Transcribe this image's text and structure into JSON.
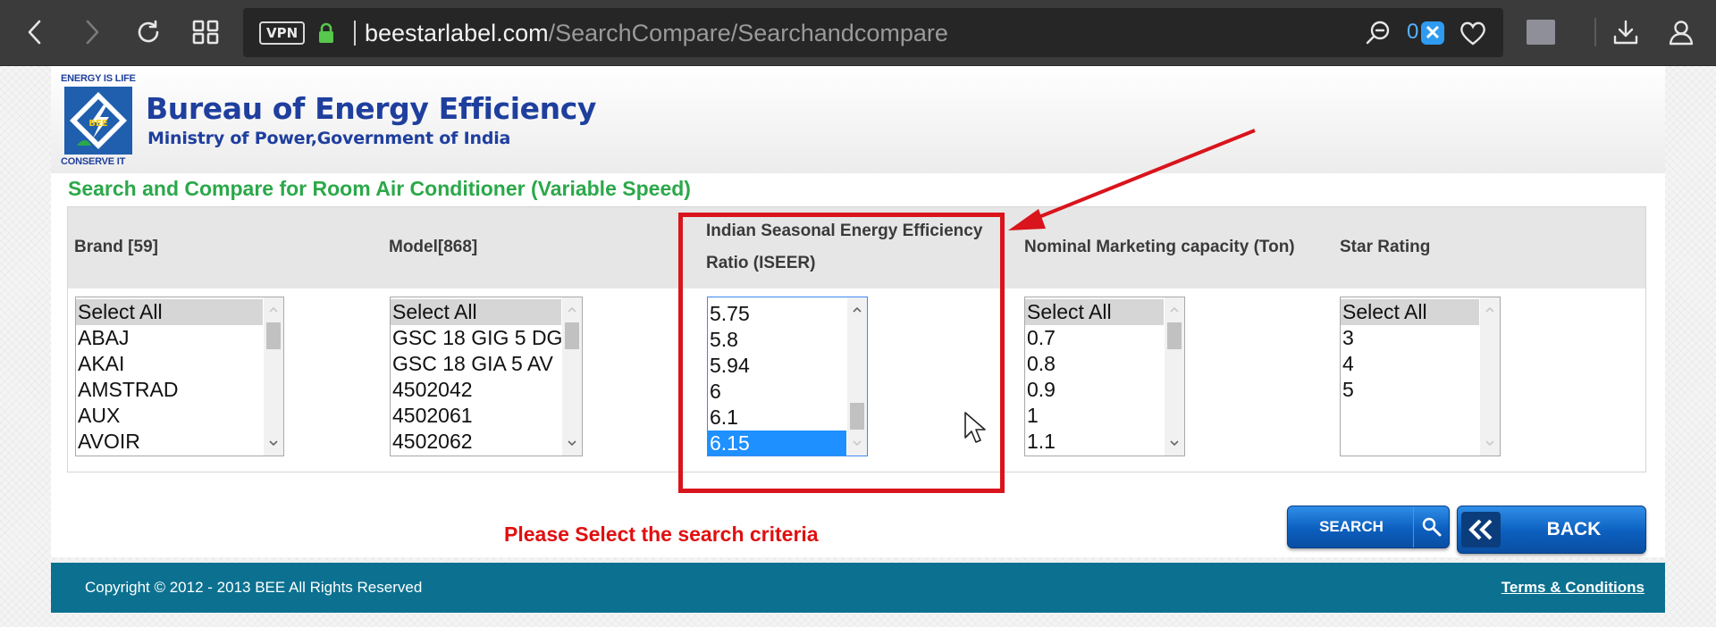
{
  "browser": {
    "vpn_label": "VPN",
    "url_host": "beestarlabel.com",
    "url_path": "/SearchCompare/Searchandcompare",
    "tracker_count": "0"
  },
  "header": {
    "logo_top_text": "ENERGY IS LIFE",
    "logo_bottom_text": "CONSERVE IT",
    "logo_emblem_text": "BEE",
    "org_name": "Bureau of Energy Efficiency",
    "org_sub": "Ministry of Power,Government of India"
  },
  "page_title": "Search and Compare for Room Air Conditioner (Variable Speed)",
  "columns": {
    "brand": {
      "label": "Brand [59]",
      "options": [
        "Select All",
        "ABAJ",
        "AKAI",
        "AMSTRAD",
        "AUX",
        "AVOIR"
      ],
      "selected": "Select All"
    },
    "model": {
      "label": "Model[868]",
      "options": [
        "Select All",
        "GSC 18 GIG 5 DG",
        "GSC 18 GIA 5 AV",
        "4502042",
        "4502061",
        "4502062"
      ],
      "selected": "Select All"
    },
    "iseer": {
      "label_line1": "Indian Seasonal Energy Efficiency",
      "label_line2": "Ratio (ISEER)",
      "options": [
        "5.75",
        "5.8",
        "5.94",
        "6",
        "6.1",
        "6.15"
      ],
      "selected": "6.15"
    },
    "capacity": {
      "label": "Nominal Marketing capacity (Ton)",
      "options": [
        "Select All",
        "0.7",
        "0.8",
        "0.9",
        "1",
        "1.1"
      ],
      "selected": "Select All"
    },
    "star": {
      "label": "Star Rating",
      "options": [
        "Select All",
        "3",
        "4",
        "5"
      ],
      "selected": "Select All"
    }
  },
  "status_message": "Please Select the search criteria",
  "buttons": {
    "search": "SEARCH",
    "back": "BACK"
  },
  "footer": {
    "copyright": "Copyright © 2012 - 2013 BEE All Rights Reserved",
    "terms": "Terms & Conditions"
  },
  "colors": {
    "title_green": "#2ca84a",
    "header_blue": "#1f3f9e",
    "annotation_red": "#d9141c",
    "footer_teal": "#0c7190",
    "selection_blue": "#1e90ff"
  }
}
